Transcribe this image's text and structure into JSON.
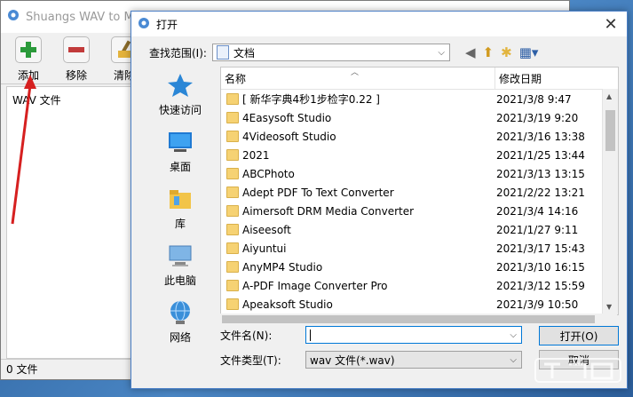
{
  "app": {
    "title": "Shuangs WAV to MP",
    "toolbar": [
      {
        "label": "添加",
        "icon": "add-icon"
      },
      {
        "label": "移除",
        "icon": "remove-icon"
      },
      {
        "label": "清除",
        "icon": "clear-icon"
      }
    ],
    "list_header": "WAV 文件",
    "status": "0 文件"
  },
  "dialog": {
    "title": "打开",
    "look_in_label": "查找范围(I):",
    "look_in_value": "文档",
    "places": [
      {
        "label": "快速访问",
        "icon": "star-icon"
      },
      {
        "label": "桌面",
        "icon": "desktop-icon"
      },
      {
        "label": "库",
        "icon": "library-icon"
      },
      {
        "label": "此电脑",
        "icon": "computer-icon"
      },
      {
        "label": "网络",
        "icon": "network-icon"
      }
    ],
    "columns": {
      "name": "名称",
      "date": "修改日期"
    },
    "files": [
      {
        "name": "[ 新华字典4秒1步检字0.22 ]",
        "date": "2021/3/8 9:47"
      },
      {
        "name": "4Easysoft Studio",
        "date": "2021/3/19 9:20"
      },
      {
        "name": "4Videosoft Studio",
        "date": "2021/3/16 13:38"
      },
      {
        "name": "2021",
        "date": "2021/1/25 13:44"
      },
      {
        "name": "ABCPhoto",
        "date": "2021/3/13 13:15"
      },
      {
        "name": "Adept PDF To Text Converter",
        "date": "2021/2/22 13:21"
      },
      {
        "name": "Aimersoft DRM Media Converter",
        "date": "2021/3/4 14:16"
      },
      {
        "name": "Aiseesoft",
        "date": "2021/1/27 9:11"
      },
      {
        "name": "Aiyuntui",
        "date": "2021/3/17 15:43"
      },
      {
        "name": "AnyMP4 Studio",
        "date": "2021/3/10 16:15"
      },
      {
        "name": "A-PDF Image Converter Pro",
        "date": "2021/3/12 15:59"
      },
      {
        "name": "Apeaksoft Studio",
        "date": "2021/3/9 10:50"
      }
    ],
    "filename_label": "文件名(N):",
    "filename_value": "",
    "filetype_label": "文件类型(T):",
    "filetype_value": "wav 文件(*.wav)",
    "open_button": "打开(O)",
    "cancel_button": "取消"
  },
  "watermark": "下载吧"
}
